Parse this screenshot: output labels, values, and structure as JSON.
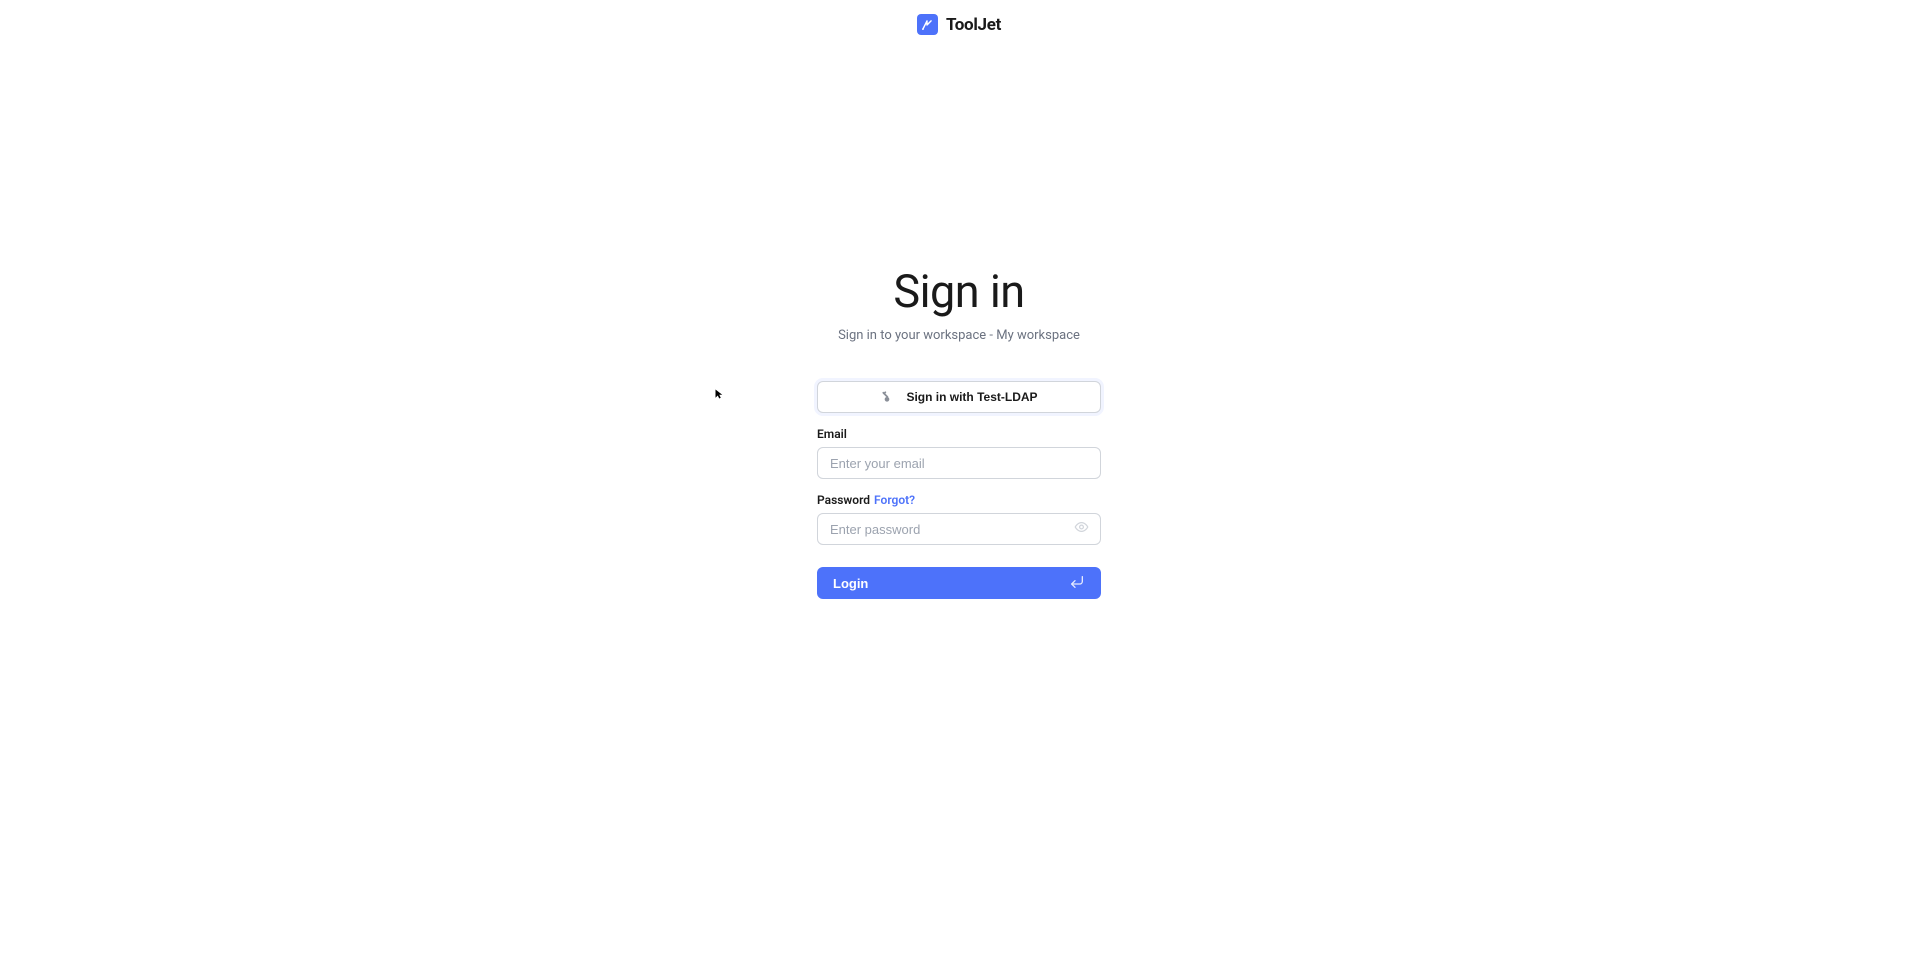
{
  "brand": {
    "name": "ToolJet"
  },
  "signin": {
    "title": "Sign in",
    "subtitle": "Sign in to your workspace - My workspace",
    "sso_label": "Sign in with Test-LDAP",
    "email_label": "Email",
    "email_placeholder": "Enter your email",
    "password_label": "Password",
    "forgot_label": "Forgot?",
    "password_placeholder": "Enter password",
    "login_label": "Login"
  }
}
